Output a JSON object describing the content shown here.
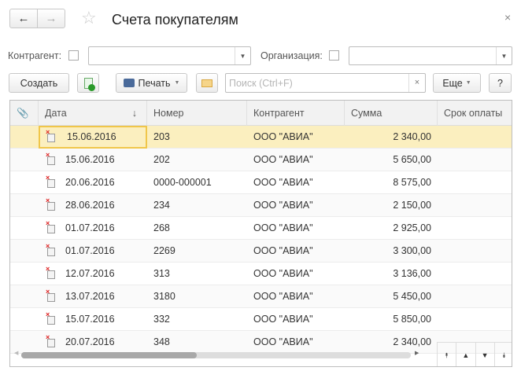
{
  "title": "Счета покупателям",
  "filters": {
    "counterparty_label": "Контрагент:",
    "counterparty_value": "",
    "organization_label": "Организация:",
    "organization_value": ""
  },
  "toolbar": {
    "create": "Создать",
    "print": "Печать",
    "search_placeholder": "Поиск (Ctrl+F)",
    "clear": "×",
    "more": "Еще",
    "help": "?"
  },
  "columns": [
    "Дата",
    "Номер",
    "Контрагент",
    "Сумма",
    "Срок оплаты"
  ],
  "rows": [
    {
      "date": "15.06.2016",
      "number": "203",
      "counterparty": "ООО \"АВИА\"",
      "sum": "2 340,00",
      "due": ""
    },
    {
      "date": "15.06.2016",
      "number": "202",
      "counterparty": "ООО \"АВИА\"",
      "sum": "5 650,00",
      "due": ""
    },
    {
      "date": "20.06.2016",
      "number": "0000-000001",
      "counterparty": "ООО \"АВИА\"",
      "sum": "8 575,00",
      "due": ""
    },
    {
      "date": "28.06.2016",
      "number": "234",
      "counterparty": "ООО \"АВИА\"",
      "sum": "2 150,00",
      "due": ""
    },
    {
      "date": "01.07.2016",
      "number": "268",
      "counterparty": "ООО \"АВИА\"",
      "sum": "2 925,00",
      "due": ""
    },
    {
      "date": "01.07.2016",
      "number": "2269",
      "counterparty": "ООО \"АВИА\"",
      "sum": "3 300,00",
      "due": ""
    },
    {
      "date": "12.07.2016",
      "number": "313",
      "counterparty": "ООО \"АВИА\"",
      "sum": "3 136,00",
      "due": ""
    },
    {
      "date": "13.07.2016",
      "number": "3180",
      "counterparty": "ООО \"АВИА\"",
      "sum": "5 450,00",
      "due": ""
    },
    {
      "date": "15.07.2016",
      "number": "332",
      "counterparty": "ООО \"АВИА\"",
      "sum": "5 850,00",
      "due": ""
    },
    {
      "date": "20.07.2016",
      "number": "348",
      "counterparty": "ООО \"АВИА\"",
      "sum": "2 340,00",
      "due": ""
    }
  ],
  "sort_indicator": "↓"
}
